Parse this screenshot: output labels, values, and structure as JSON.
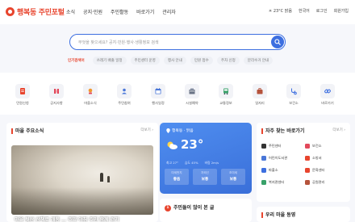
{
  "header": {
    "logo_text": "행복동 주민포털",
    "nav": [
      "소식",
      "공지·민원",
      "주민활동",
      "바로가기",
      "관리자"
    ],
    "weather_label": "23°C 맑음",
    "language": "한국어",
    "login": "로그인",
    "signup": "회원가입"
  },
  "search": {
    "placeholder": "무엇을 찾으세요? 공지·민원·행사·생활정보 검색",
    "keywords_title": "인기검색어",
    "keywords": [
      "쓰레기 배출 일정",
      "주민센터 운영",
      "행사 안내",
      "민원 접수",
      "주차 신청",
      "분리수거 안내"
    ]
  },
  "quick_menu": [
    {
      "label": "민원신청",
      "icon": "document-icon",
      "color": "#e8452e"
    },
    {
      "label": "공지사항",
      "icon": "megaphone-icon",
      "color": "#e2495b"
    },
    {
      "label": "마을소식",
      "icon": "news-icon",
      "color": "#f0962e"
    },
    {
      "label": "주민참여",
      "icon": "people-icon",
      "color": "#4a77d8"
    },
    {
      "label": "행사일정",
      "icon": "calendar-icon",
      "color": "#4a77d8"
    },
    {
      "label": "시설예약",
      "icon": "building-icon",
      "color": "#6a7386"
    },
    {
      "label": "교통정보",
      "icon": "bus-icon",
      "color": "#38a169"
    },
    {
      "label": "일자리",
      "icon": "briefcase-icon",
      "color": "#b5533c"
    },
    {
      "label": "보건소",
      "icon": "stethoscope-icon",
      "color": "#3d6fe0"
    },
    {
      "label": "바로가기",
      "icon": "link-icon",
      "color": "#3d6fe0"
    }
  ],
  "news": {
    "title": "마을 주요소식",
    "more": "더보기 ›",
    "caption": "마을 뒷산 산책로 개통 … 주말 아침 주민 함께 걷기"
  },
  "weather": {
    "location": "행복동 · 맑음",
    "temperature": "23°",
    "stats": [
      "최고 27°",
      "습도 45%",
      "바람 2m/s"
    ],
    "boxes": [
      {
        "label": "미세먼지",
        "value": "좋음"
      },
      {
        "label": "자외선",
        "value": "보통"
      },
      {
        "label": "초미세",
        "value": "보통"
      }
    ]
  },
  "hot": {
    "number": "1",
    "title": "주민들이 많이 본 글"
  },
  "favorites": {
    "title": "자주 찾는 바로가기",
    "more": "더보기 ›",
    "items": [
      {
        "label": "주민센터",
        "color": "#333"
      },
      {
        "label": "보건소",
        "color": "#e2495b"
      },
      {
        "label": "어린이도서관",
        "color": "#4a77d8"
      },
      {
        "label": "소방서",
        "color": "#e8452e"
      },
      {
        "label": "파출소",
        "color": "#3d6fe0"
      },
      {
        "label": "문화센터",
        "color": "#e8452e"
      },
      {
        "label": "복지관센터",
        "color": "#38a169"
      },
      {
        "label": "공원관리",
        "color": "#b5533c"
      }
    ]
  },
  "orgs": {
    "title": "우리 마을 동영"
  }
}
